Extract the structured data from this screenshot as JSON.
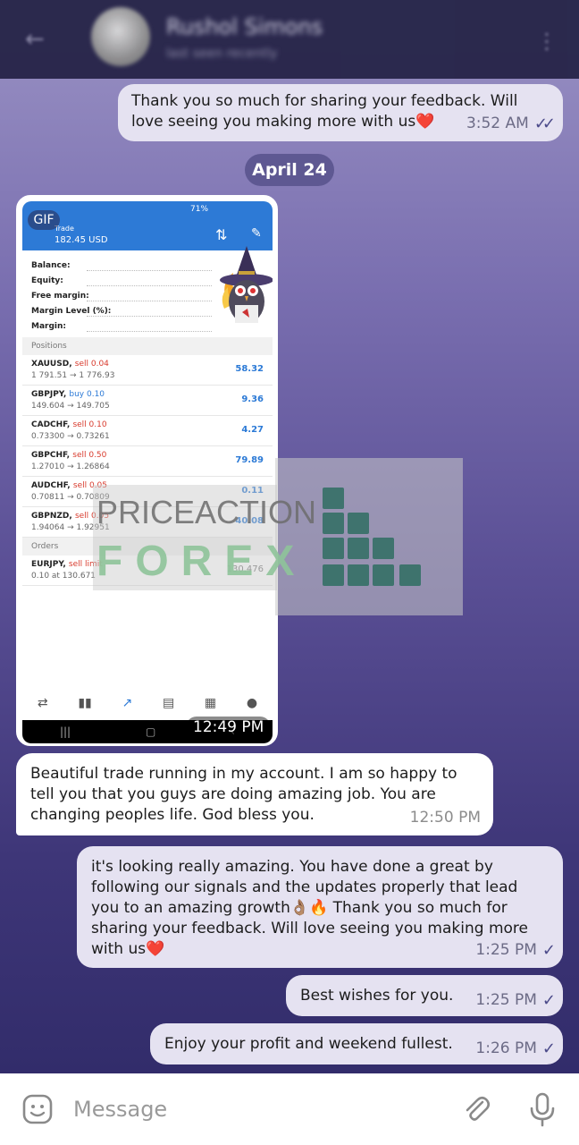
{
  "header": {
    "contact_name": "Rushol Simons",
    "status": "last seen recently"
  },
  "messages": {
    "m1": {
      "text": "Thank you so much for sharing your feedback. Will love seeing you making more with us❤️",
      "time": "3:52 AM",
      "status": "read"
    },
    "date_chip": "April 24",
    "gif": {
      "badge": "GIF",
      "time": "12:49 PM"
    },
    "m2": {
      "text": "Beautiful trade running in my account. I am so happy to tell you that you guys are doing amazing job. You are changing peoples life. God bless you.",
      "time": "12:50 PM"
    },
    "m3": {
      "text": "it's looking really amazing. You have done a great by following our signals and the updates properly that lead you to an amazing growth👌🏽🔥 Thank you so much for sharing your feedback. Will love seeing you making more with us❤️",
      "time": "1:25 PM",
      "status": "sent"
    },
    "m4": {
      "text": "Best wishes for you.",
      "time": "1:25 PM",
      "status": "sent"
    },
    "m5": {
      "text": "Enjoy your profit and weekend fullest.",
      "time": "1:26 PM",
      "status": "sent"
    }
  },
  "screenshot": {
    "status_bar": "71%",
    "label": "Trade",
    "balance": "182.45 USD",
    "account_rows": [
      "Balance:",
      "Equity:",
      "Free margin:",
      "Margin Level (%):",
      "Margin:"
    ],
    "positions_title": "Positions",
    "positions": [
      {
        "symbol": "XAUUSD,",
        "side": "sell 0.04",
        "prices": "1 791.51 → 1 776.93",
        "pl": "58.32"
      },
      {
        "symbol": "GBPJPY,",
        "side": "buy 0.10",
        "prices": "149.604 → 149.705",
        "pl": "9.36"
      },
      {
        "symbol": "CADCHF,",
        "side": "sell 0.10",
        "prices": "0.73300 → 0.73261",
        "pl": "4.27"
      },
      {
        "symbol": "GBPCHF,",
        "side": "sell 0.50",
        "prices": "1.27010 → 1.26864",
        "pl": "79.89"
      },
      {
        "symbol": "AUDCHF,",
        "side": "sell 0.05",
        "prices": "0.70811 → 0.70809",
        "pl": "0.11"
      },
      {
        "symbol": "GBPNZD,",
        "side": "sell 0.05",
        "prices": "1.94064 → 1.92951",
        "pl": "40.08"
      }
    ],
    "orders_title": "Orders",
    "order": {
      "symbol": "EURJPY,",
      "side": "sell limit",
      "prices": "0.10 at 130.671",
      "pl": "130.476"
    }
  },
  "watermark": {
    "line1": "PRICEACTION",
    "line2": "FOREX"
  },
  "input": {
    "placeholder": "Message"
  },
  "colors": {
    "outgoing": "#e5e2f1",
    "incoming": "#ffffff",
    "header": "#272549",
    "date_chip": "#5e5892"
  }
}
